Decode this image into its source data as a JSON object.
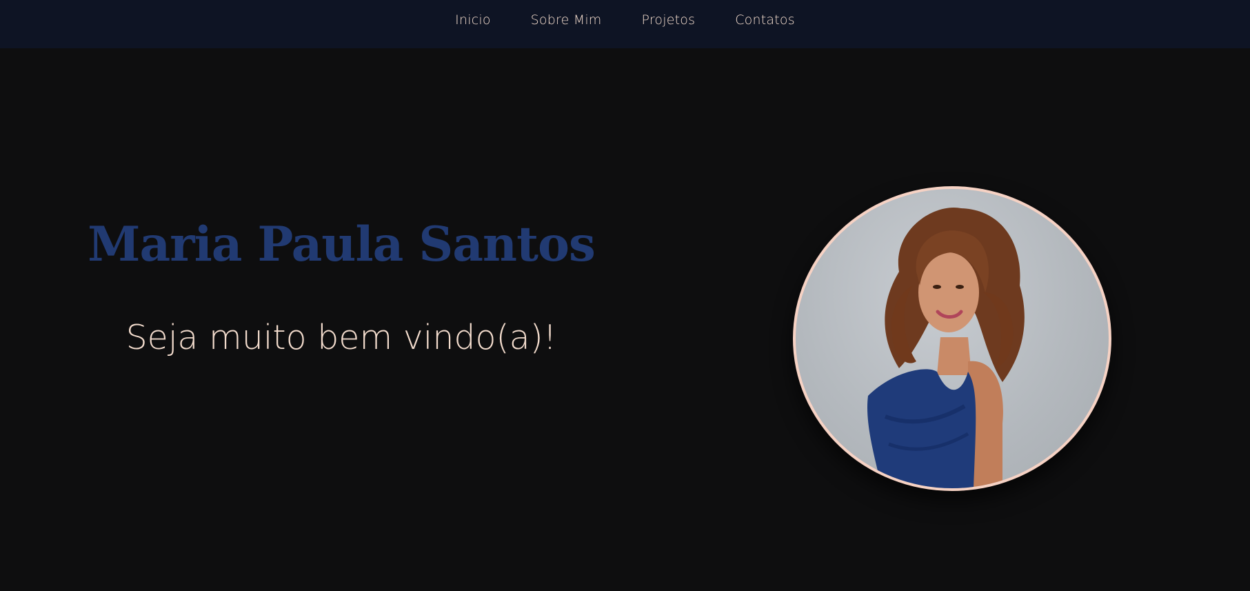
{
  "nav": {
    "items": [
      {
        "label": "Inicio"
      },
      {
        "label": "Sobre Mim"
      },
      {
        "label": "Projetos"
      },
      {
        "label": "Contatos"
      }
    ]
  },
  "hero": {
    "name": "Maria Paula Santos",
    "welcome": "Seja muito bem vindo(a)!"
  },
  "colors": {
    "nav_background": "#0e1424",
    "page_background": "#0e0e0f",
    "name_color": "#213a72",
    "text_color": "#f3dccd",
    "photo_border": "#f6d2c4"
  },
  "profile_photo": {
    "icon": "profile-photo"
  }
}
